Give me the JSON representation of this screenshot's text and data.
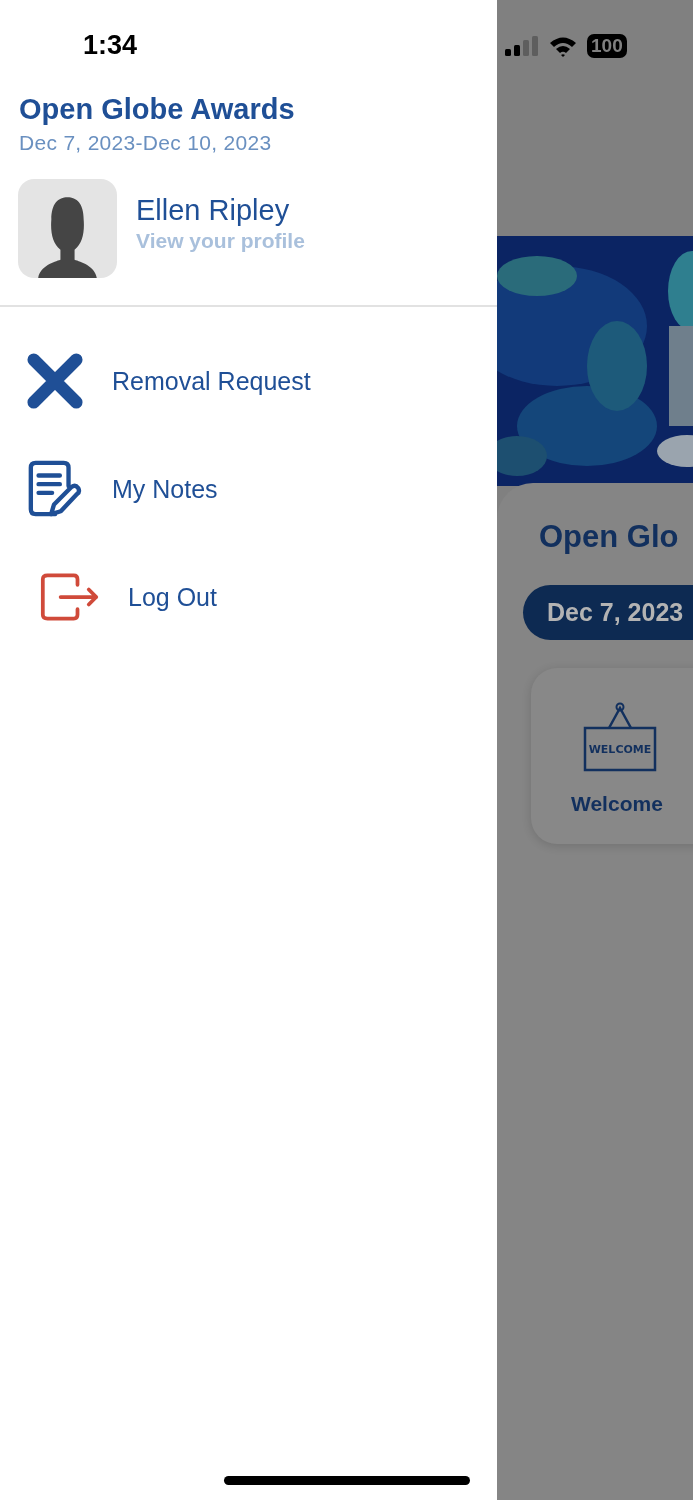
{
  "status_bar": {
    "time": "1:34",
    "battery": "100"
  },
  "drawer": {
    "event_title": "Open Globe Awards",
    "event_dates": "Dec 7, 2023-Dec 10, 2023",
    "profile": {
      "name": "Ellen Ripley",
      "link": "View your profile"
    },
    "menu": [
      {
        "kind": "remove",
        "label": "Removal Request"
      },
      {
        "kind": "notes",
        "label": "My Notes"
      },
      {
        "kind": "logout",
        "label": "Log Out"
      }
    ]
  },
  "background_screen": {
    "title": "Open Glo",
    "date_pill": "Dec 7, 2023",
    "tile": {
      "sign_text": "WELCOME",
      "label": "Welcome"
    }
  }
}
